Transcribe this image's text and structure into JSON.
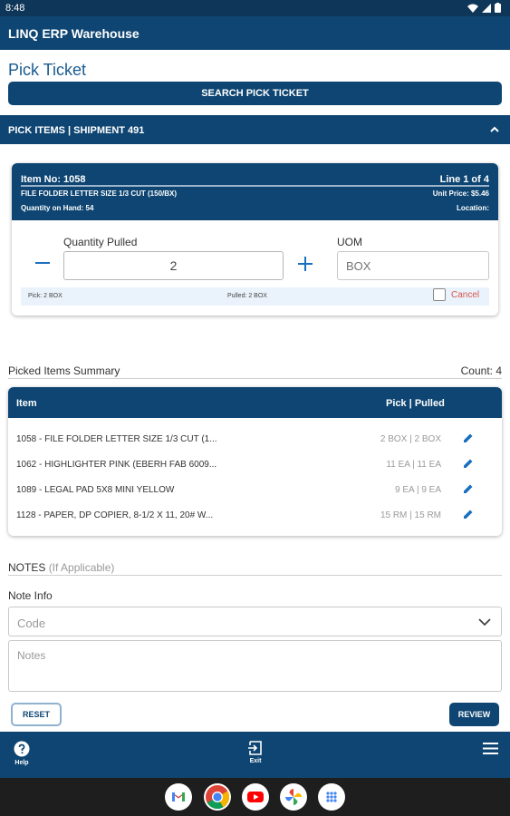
{
  "status_bar": {
    "time": "8:48"
  },
  "app": {
    "title": "LINQ ERP Warehouse"
  },
  "page": {
    "title": "Pick Ticket"
  },
  "search": {
    "button_label": "SEARCH PICK TICKET"
  },
  "section": {
    "title": "PICK ITEMS | SHIPMENT 491"
  },
  "current_item": {
    "item_no": "Item No: 1058",
    "line": "Line 1 of 4",
    "description": "FILE FOLDER LETTER SIZE 1/3 CUT (150/BX)",
    "unit_price": "Unit Price: $5.46",
    "quantity_on_hand": "Quantity on Hand: 54",
    "location": "Location:",
    "quantity_label": "Quantity Pulled",
    "quantity_value": "2",
    "uom_label": "UOM",
    "uom_placeholder": "BOX",
    "pick": "Pick: 2 BOX",
    "pulled": "Pulled: 2 BOX",
    "cancel_label": "Cancel"
  },
  "summary": {
    "title": "Picked Items Summary",
    "count": "Count: 4",
    "columns": {
      "item": "Item",
      "pick_pulled": "Pick | Pulled"
    },
    "rows": [
      {
        "item": "1058 - FILE FOLDER LETTER SIZE 1/3 CUT (1...",
        "pick_pulled": "2 BOX | 2 BOX"
      },
      {
        "item": "1062 - HIGHLIGHTER PINK (EBERH FAB 6009...",
        "pick_pulled": "11 EA | 11 EA"
      },
      {
        "item": "1089 - LEGAL PAD  5X8 MINI YELLOW",
        "pick_pulled": "9 EA | 9 EA"
      },
      {
        "item": "1128 - PAPER, DP COPIER, 8-1/2 X 11, 20# W...",
        "pick_pulled": "15 RM | 15 RM"
      }
    ]
  },
  "notes": {
    "title": "NOTES",
    "subtitle": "(If Applicable)",
    "note_info_label": "Note Info",
    "code_placeholder": "Code",
    "notes_placeholder": "Notes"
  },
  "actions": {
    "reset_label": "RESET",
    "review_label": "REVIEW"
  },
  "bottom_nav": {
    "help_label": "Help",
    "exit_label": "Exit"
  },
  "colors": {
    "primary": "#0e4572",
    "accent": "#1a6fc0",
    "cancel": "#d9534f"
  },
  "dock_apps": [
    "gmail-icon",
    "chrome-icon",
    "youtube-icon",
    "photos-icon",
    "apps-icon"
  ]
}
